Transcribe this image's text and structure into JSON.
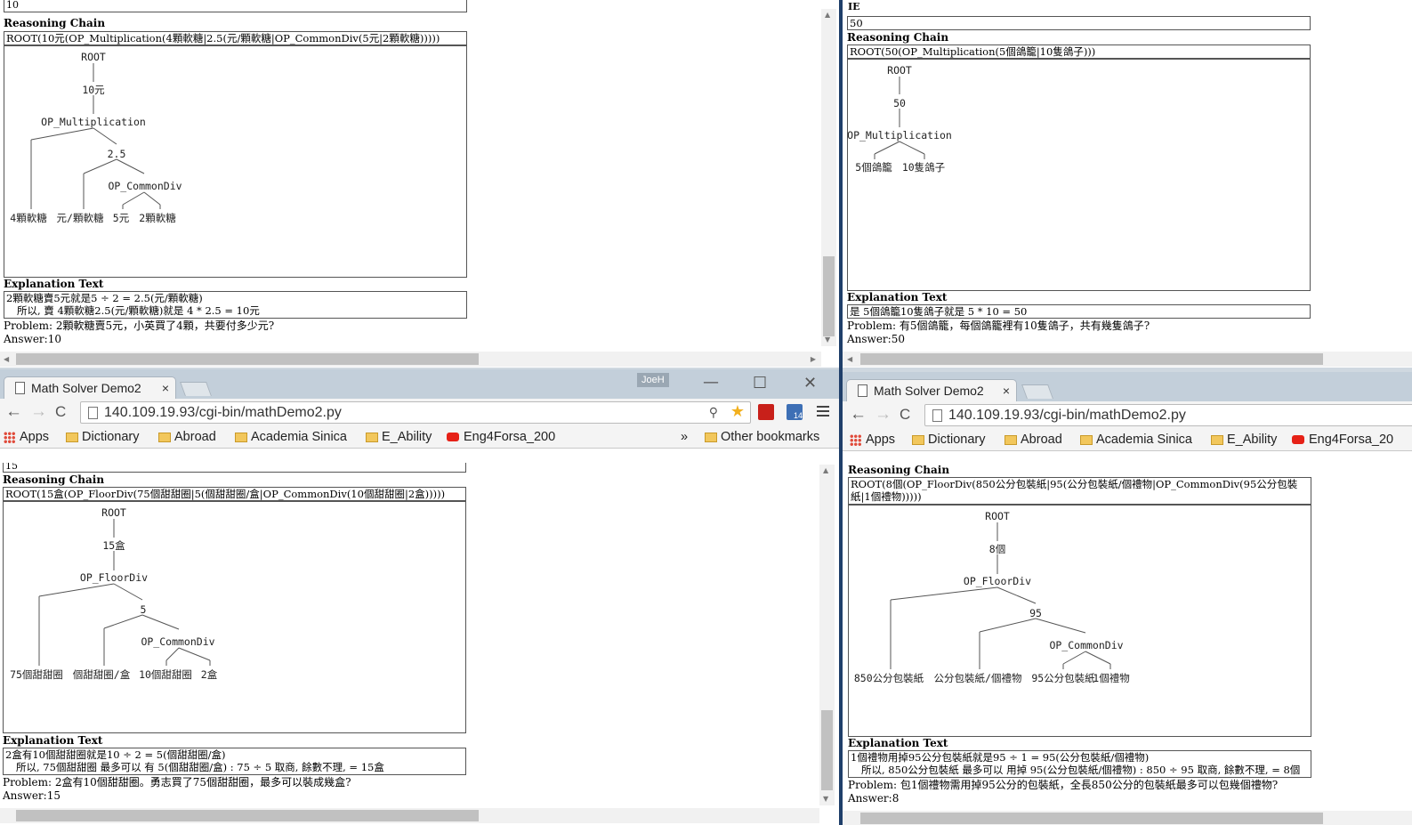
{
  "panes": {
    "tl": {
      "top_value": "10",
      "rc_label": "Reasoning Chain",
      "chain": "ROOT(10元(OP_Multiplication(4顆軟糖|2.5(元/顆軟糖|OP_CommonDiv(5元|2顆軟糖)))))",
      "tree": [
        "ROOT",
        "10元",
        "OP_Multiplication",
        "2.5",
        "OP_CommonDiv",
        "4顆軟糖",
        "元/顆軟糖",
        "5元",
        "2顆軟糖"
      ],
      "et_label": "Explanation Text",
      "explanation": [
        "2顆軟糖賣5元就是5 ÷ 2 = 2.5(元/顆軟糖)",
        "所以, 賣 4顆軟糖2.5(元/顆軟糖)就是 4 * 2.5 = 10元"
      ],
      "problem": "Problem: 2顆軟糖賣5元，小英買了4顆，共要付多少元?",
      "answer": "Answer:10"
    },
    "tr": {
      "ie_label": "IE",
      "top_value": "50",
      "rc_label": "Reasoning Chain",
      "chain": "ROOT(50(OP_Multiplication(5個鴿籠|10隻鴿子)))",
      "tree": [
        "ROOT",
        "50",
        "OP_Multiplication",
        "5個鴿籠",
        "10隻鴿子"
      ],
      "et_label": "Explanation Text",
      "explanation": [
        "是 5個鴿籠10隻鴿子就是 5 * 10 = 50"
      ],
      "problem": "Problem: 有5個鴿籠，每個鴿籠裡有10隻鴿子，共有幾隻鴿子?",
      "answer": "Answer:50"
    },
    "bl": {
      "top_value": "15",
      "rc_label": "Reasoning Chain",
      "chain": "ROOT(15盒(OP_FloorDiv(75個甜甜圈|5(個甜甜圈/盒|OP_CommonDiv(10個甜甜圈|2盒)))))",
      "tree": [
        "ROOT",
        "15盒",
        "OP_FloorDiv",
        "5",
        "OP_CommonDiv",
        "75個甜甜圈",
        "個甜甜圈/盒",
        "10個甜甜圈",
        "2盒"
      ],
      "et_label": "Explanation Text",
      "explanation": [
        "2盒有10個甜甜圈就是10 ÷ 2 = 5(個甜甜圈/盒)",
        "所以, 75個甜甜圈 最多可以 有 5(個甜甜圈/盒) : 75 ÷ 5 取商, 餘數不理, = 15盒"
      ],
      "problem": "Problem: 2盒有10個甜甜圈。勇志買了75個甜甜圈，最多可以裝成幾盒?",
      "answer": "Answer:15"
    },
    "br": {
      "rc_label": "Reasoning Chain",
      "chain": "ROOT(8個(OP_FloorDiv(850公分包裝紙|95(公分包裝紙/個禮物|OP_CommonDiv(95公分包裝紙|1個禮物)))))",
      "tree": [
        "ROOT",
        "8個",
        "OP_FloorDiv",
        "95",
        "OP_CommonDiv",
        "850公分包裝紙",
        "公分包裝紙/個禮物",
        "95公分包裝紙",
        "1個禮物"
      ],
      "et_label": "Explanation Text",
      "explanation": [
        "1個禮物用掉95公分包裝紙就是95 ÷ 1 = 95(公分包裝紙/個禮物)",
        "所以, 850公分包裝紙 最多可以 用掉 95(公分包裝紙/個禮物) : 850 ÷ 95 取商, 餘數不理, = 8個"
      ],
      "problem": "Problem: 包1個禮物需用掉95公分的包裝紙，全長850公分的包裝紙最多可以包幾個禮物?",
      "answer": "Answer:8"
    }
  },
  "browser": {
    "tab_title": "Math Solver Demo2",
    "tab_close": "×",
    "url": "140.109.19.93/cgi-bin/mathDemo2.py",
    "user": "JoeH",
    "ext_badge": "14",
    "bookmarks": [
      "Apps",
      "Dictionary",
      "Abroad",
      "Academia Sinica",
      "E_Ability",
      "Eng4Forsa_200"
    ],
    "bookmarks_right": [
      "Eng4Forsa_20"
    ],
    "more": "»",
    "other_bookmarks": "Other bookmarks",
    "window_controls": [
      "—",
      "☐",
      "✕"
    ],
    "nav": [
      "←",
      "→",
      "C"
    ]
  },
  "icons": [
    "page-icon",
    "folder-icon",
    "apps-grid-icon",
    "youtube-icon",
    "search-icon",
    "star-icon",
    "pdf-icon",
    "extension-icon",
    "menu-icon"
  ]
}
